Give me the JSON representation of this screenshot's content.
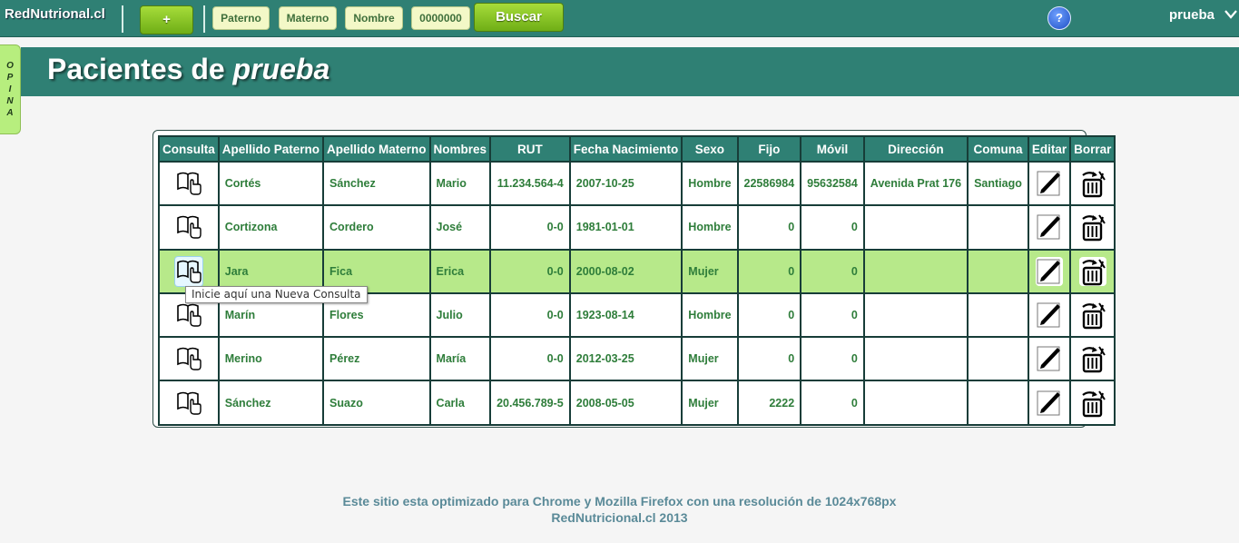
{
  "header": {
    "brand": "RedNutrional.cl",
    "add_label": "+",
    "fields": {
      "paterno": "Paterno",
      "materno": "Materno",
      "nombre": "Nombre",
      "rut": "0000000"
    },
    "search_label": "Buscar",
    "help_label": "?",
    "user": "prueba"
  },
  "side_tab": {
    "label": [
      "O",
      "P",
      "I",
      "N",
      "A"
    ]
  },
  "page": {
    "title_prefix": "Pacientes de ",
    "title_emphasis": "prueba"
  },
  "table": {
    "columns": [
      "Consulta",
      "Apellido Paterno",
      "Apellido Materno",
      "Nombres",
      "RUT",
      "Fecha Nacimiento",
      "Sexo",
      "Fijo",
      "Móvil",
      "Dirección",
      "Comuna",
      "Editar",
      "Borrar"
    ],
    "rows": [
      {
        "paterno": "Cortés",
        "materno": "Sánchez",
        "nombres": "Mario",
        "rut": "11.234.564-4",
        "nacimiento": "2007-10-25",
        "sexo": "Hombre",
        "fijo": "22586984",
        "movil": "95632584",
        "direccion": "Avenida Prat 176",
        "comuna": "Santiago"
      },
      {
        "paterno": "Cortizona",
        "materno": "Cordero",
        "nombres": "José",
        "rut": "0-0",
        "nacimiento": "1981-01-01",
        "sexo": "Hombre",
        "fijo": "0",
        "movil": "0",
        "direccion": "",
        "comuna": ""
      },
      {
        "paterno": "Jara",
        "materno": "Fica",
        "nombres": "Erica",
        "rut": "0-0",
        "nacimiento": "2000-08-02",
        "sexo": "Mujer",
        "fijo": "0",
        "movil": "0",
        "direccion": "",
        "comuna": ""
      },
      {
        "paterno": "Marín",
        "materno": "Flores",
        "nombres": "Julio",
        "rut": "0-0",
        "nacimiento": "1923-08-14",
        "sexo": "Hombre",
        "fijo": "0",
        "movil": "0",
        "direccion": "",
        "comuna": ""
      },
      {
        "paterno": "Merino",
        "materno": "Pérez",
        "nombres": "María",
        "rut": "0-0",
        "nacimiento": "2012-03-25",
        "sexo": "Mujer",
        "fijo": "0",
        "movil": "0",
        "direccion": "",
        "comuna": ""
      },
      {
        "paterno": "Sánchez",
        "materno": "Suazo",
        "nombres": "Carla",
        "rut": "20.456.789-5",
        "nacimiento": "2008-05-05",
        "sexo": "Mujer",
        "fijo": "2222",
        "movil": "0",
        "direccion": "",
        "comuna": ""
      }
    ],
    "highlighted_row": 2
  },
  "tooltip": "Inicie aquí una Nueva Consulta",
  "footer": {
    "line1": "Este sitio esta optimizado para Chrome y Mozilla Firefox con una resolución de 1024x768px",
    "line2": "RedNutricional.cl 2013"
  },
  "colors": {
    "primary": "#2f8074",
    "highlight_row": "#b7e98a",
    "button_green": "#8cc62a",
    "text_green": "#2e7d3a"
  },
  "icons": {
    "consult": "book-hand-icon",
    "edit": "pencil-icon",
    "delete": "trash-icon",
    "help": "help-icon",
    "user_menu": "chevron-down-icon"
  }
}
